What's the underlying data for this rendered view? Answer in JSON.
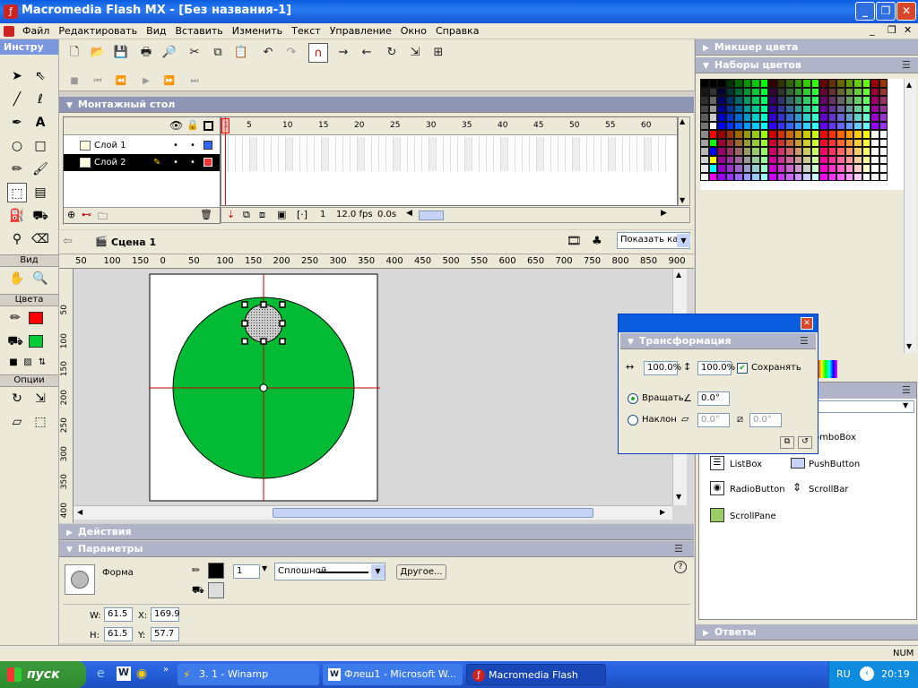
{
  "window": {
    "title": "Macromedia Flash MX - [Без названия-1]"
  },
  "menu": [
    "Файл",
    "Редактировать",
    "Вид",
    "Вставить",
    "Изменить",
    "Текст",
    "Управление",
    "Окно",
    "Справка"
  ],
  "toolbox": {
    "title": "Инстру",
    "view_label": "Вид",
    "colors_label": "Цвета",
    "options_label": "Опции",
    "stroke_color": "#ff0000",
    "fill_color": "#00cc33"
  },
  "timeline": {
    "title": "Монтажный стол",
    "frame_numbers": [
      "1",
      "5",
      "10",
      "15",
      "20",
      "25",
      "30",
      "35",
      "40",
      "45",
      "50",
      "55",
      "60"
    ],
    "layers": [
      {
        "name": "Слой 1",
        "color": "#3366ff"
      },
      {
        "name": "Слой 2",
        "color": "#ff3333"
      }
    ],
    "current_frame": "1",
    "fps": "12.0 fps",
    "time": "0.0s"
  },
  "stage": {
    "scene": "Сцена 1",
    "zoom": "Показать ка",
    "hruler": [
      "50",
      "100",
      "150",
      "0",
      "50",
      "100",
      "150",
      "200",
      "250",
      "300",
      "350",
      "400",
      "450",
      "500",
      "550",
      "600",
      "650",
      "700",
      "750",
      "800",
      "850",
      "900"
    ],
    "vruler": [
      "50",
      "100",
      "150",
      "200",
      "250",
      "300",
      "350",
      "400"
    ],
    "circle_color": "#00bb33"
  },
  "panels": {
    "actions": "Действия",
    "params": "Параметры",
    "shape_label": "Форма",
    "stroke_width": "1",
    "stroke_style": "Сплошной",
    "other_button": "Другое...",
    "w_label": "W:",
    "w_value": "61.5",
    "h_label": "H:",
    "h_value": "61.5",
    "x_label": "X:",
    "x_value": "169.9",
    "y_label": "Y:",
    "y_value": "57.7"
  },
  "right": {
    "color_mixer": "Микшер цвета",
    "swatches": "Наборы цветов",
    "components": [
      "omboBox",
      "ListBox",
      "PushButton",
      "RadioButton",
      "ScrollBar",
      "ScrollPane"
    ],
    "answers": "Ответы"
  },
  "transform": {
    "title": "Трансформация",
    "width_pct": "100.0%",
    "height_pct": "100.0%",
    "keep_label": "Сохранять",
    "rotate_label": "Вращать",
    "rotate_value": "0.0°",
    "skew_label": "Наклон",
    "skew_h": "0.0°",
    "skew_v": "0.0°"
  },
  "status": {
    "num": "NUM"
  },
  "taskbar": {
    "start": "пуск",
    "tasks": [
      "3. 1 - Winamp",
      "Флеш1 - Microsoft W...",
      "Macromedia Flash MX..."
    ],
    "lang": "RU",
    "clock": "20:19"
  }
}
